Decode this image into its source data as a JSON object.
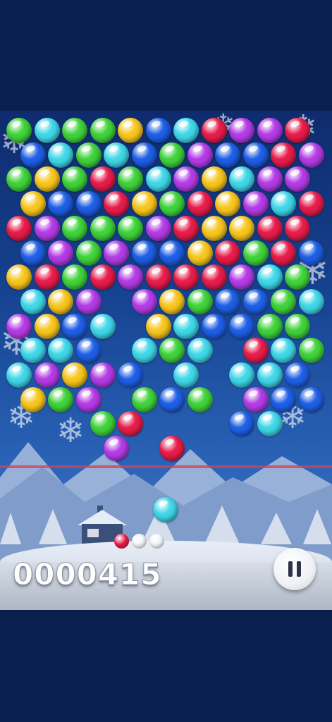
{
  "score": "0000415",
  "colors": {
    "green": "#3fd23a",
    "cyan": "#3fd7e8",
    "yellow": "#f7c51b",
    "blue": "#1e5fe6",
    "red": "#e81c4a",
    "purple": "#b43be6"
  },
  "icons": {
    "pause": "pause-icon",
    "snowflake": "snowflake-icon",
    "house": "house-icon"
  },
  "board": {
    "rows": [
      [
        "green",
        "cyan",
        "green",
        "green",
        "yellow",
        "blue",
        "cyan",
        "red",
        "purple",
        "purple",
        "red"
      ],
      [
        "blue",
        "cyan",
        "green",
        "cyan",
        "blue",
        "green",
        "purple",
        "blue",
        "blue",
        "red",
        "purple"
      ],
      [
        "green",
        "yellow",
        "green",
        "red",
        "green",
        "cyan",
        "purple",
        "yellow",
        "cyan",
        "purple",
        "purple"
      ],
      [
        "yellow",
        "blue",
        "blue",
        "red",
        "yellow",
        "green",
        "red",
        "yellow",
        "purple",
        "cyan",
        "red"
      ],
      [
        "red",
        "purple",
        "green",
        "green",
        "green",
        "purple",
        "red",
        "yellow",
        "yellow",
        "red",
        "red"
      ],
      [
        "blue",
        "purple",
        "green",
        "purple",
        "blue",
        "blue",
        "yellow",
        "red",
        "green",
        "red",
        "blue"
      ],
      [
        "yellow",
        "red",
        "green",
        "red",
        "purple",
        "red",
        "red",
        "red",
        "purple",
        "cyan",
        "green"
      ],
      [
        "cyan",
        "yellow",
        "purple",
        null,
        "purple",
        "yellow",
        "green",
        "blue",
        "blue",
        "green",
        "cyan"
      ],
      [
        "purple",
        "yellow",
        "blue",
        "cyan",
        null,
        "yellow",
        "cyan",
        "blue",
        "blue",
        "green",
        "green"
      ],
      [
        "cyan",
        "cyan",
        "blue",
        null,
        "cyan",
        "green",
        "cyan",
        null,
        "red",
        "cyan",
        "green"
      ],
      [
        "cyan",
        "purple",
        "yellow",
        "purple",
        "blue",
        null,
        "cyan",
        null,
        "cyan",
        "cyan",
        "blue"
      ],
      [
        "yellow",
        "green",
        "purple",
        null,
        "green",
        "blue",
        "green",
        null,
        "purple",
        "blue",
        "blue"
      ],
      [
        null,
        null,
        null,
        "green",
        "red",
        null,
        null,
        null,
        "blue",
        "cyan",
        null
      ],
      [
        null,
        null,
        null,
        "purple",
        null,
        "red",
        null,
        null,
        null,
        null,
        null
      ]
    ]
  },
  "shooter": {
    "current": "cyan",
    "queue": [
      "red",
      "white",
      "white"
    ]
  }
}
